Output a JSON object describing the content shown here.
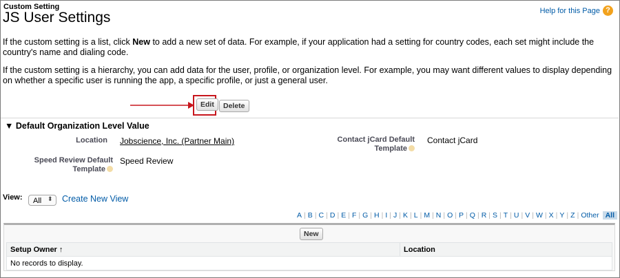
{
  "header": {
    "eyebrow": "Custom Setting",
    "title": "JS User Settings",
    "help_link": "Help for this Page",
    "help_icon_glyph": "?"
  },
  "intro": {
    "p1_before": "If the custom setting is a list, click ",
    "p1_bold": "New",
    "p1_after": " to add a new set of data. For example, if your application had a setting for country codes, each set might include the country's name and dialing code.",
    "p2": "If the custom setting is a hierarchy, you can add data for the user, profile, or organization level. For example, you may want different values to display depending on whether a specific user is running the app, a specific profile, or just a general user."
  },
  "buttons": {
    "edit": "Edit",
    "delete": "Delete",
    "new": "New"
  },
  "section": {
    "title": "Default Organization Level Value",
    "toggle_glyph": "▼",
    "fields": {
      "location_label": "Location",
      "location_value": "Jobscience, Inc. (Partner Main)",
      "contact_label_1": "Contact jCard Default",
      "contact_label_2": "Template",
      "contact_value": "Contact jCard",
      "speed_label_1": "Speed Review Default",
      "speed_label_2": "Template",
      "speed_value": "Speed Review"
    }
  },
  "view": {
    "label": "View:",
    "selected": "All",
    "chevron_glyph": "⌃⌄",
    "create_link": "Create New View"
  },
  "alphabet": [
    "A",
    "B",
    "C",
    "D",
    "E",
    "F",
    "G",
    "H",
    "I",
    "J",
    "K",
    "L",
    "M",
    "N",
    "O",
    "P",
    "Q",
    "R",
    "S",
    "T",
    "U",
    "V",
    "W",
    "X",
    "Y",
    "Z",
    "Other",
    "All"
  ],
  "table": {
    "columns": [
      "Setup Owner",
      "Location"
    ],
    "sort_glyph": "↑",
    "empty_message": "No records to display."
  },
  "colors": {
    "link": "#015ba7",
    "highlight": "#c7161d",
    "help_icon": "#f2a21d"
  }
}
